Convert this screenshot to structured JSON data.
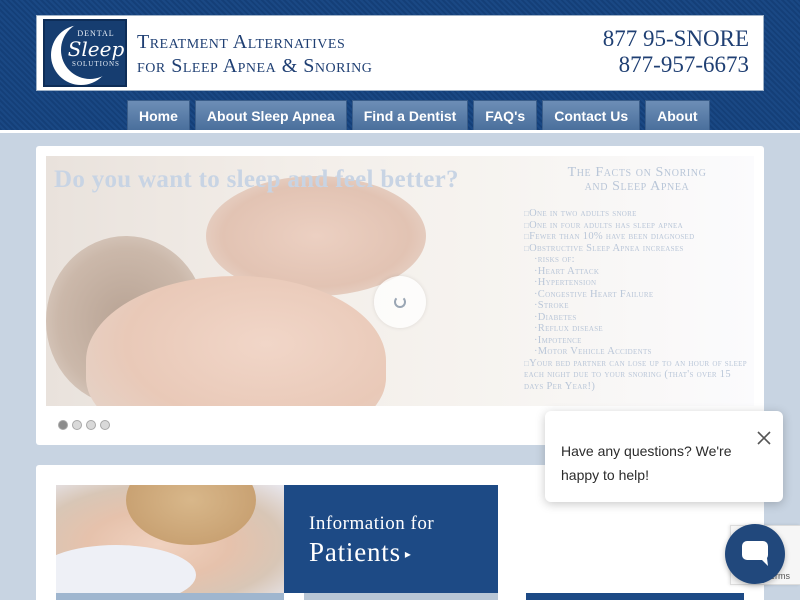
{
  "header": {
    "logo": {
      "line1": "DENTAL",
      "line2": "Sleep",
      "line3": "SOLUTIONS"
    },
    "tagline": [
      "Treatment Alternatives",
      "for Sleep Apnea & Snoring"
    ],
    "phones": [
      "877 95-SNORE",
      "877-957-6673"
    ]
  },
  "nav": {
    "items": [
      "Home",
      "About Sleep Apnea",
      "Find a Dentist",
      "FAQ's",
      "Contact Us",
      "About"
    ]
  },
  "slider": {
    "headline": "Do you want to sleep and feel better?",
    "facts_title": [
      "The Facts on Snoring",
      "and Sleep Apnea"
    ],
    "facts": [
      "One in two adults snore",
      "One in four adults has sleep apnea",
      "Fewer than 10% have been diagnosed",
      "Obstructive Sleep Apnea increases"
    ],
    "risks_label": "risks of:",
    "risks": [
      "Heart Attack",
      "Hypertension",
      "Congestive Heart Failure",
      "Stroke",
      "Diabetes",
      "Reflux disease",
      "Impotence",
      "Motor Vehicle Accidents"
    ],
    "partner_fact": "Your bed partner can lose up to an hour of sleep each night due to your snoring (that's over 15 days Per Year!)",
    "slide_count": 4,
    "active_slide": 1
  },
  "patients_banner": {
    "line1": "Information for",
    "line2": "Patients",
    "arrow": "▸"
  },
  "chat": {
    "message": "Have any questions? We're happy to help!",
    "close_glyph": "✕"
  },
  "recaptcha": {
    "text": "erms"
  },
  "colors": {
    "header_blue": "#1a4884",
    "nav_button": "#5a7ca8",
    "brand_navy": "#1f3f73",
    "page_bg": "#c8d4e2",
    "chat_button": "#21487c"
  }
}
